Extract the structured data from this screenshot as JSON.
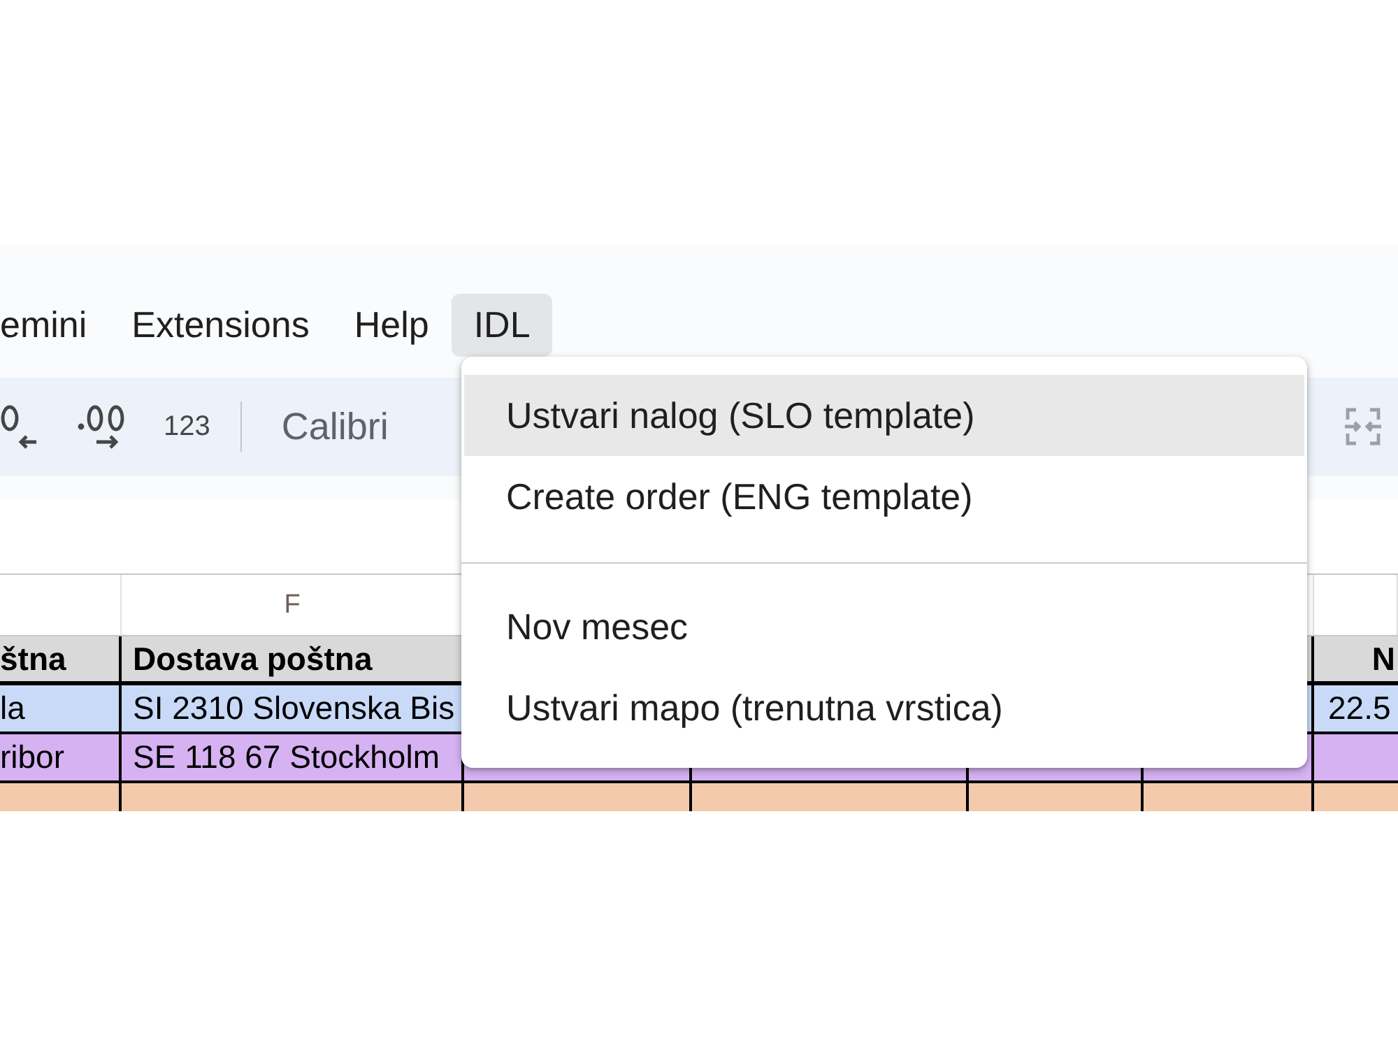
{
  "menu_bar": {
    "items": [
      {
        "label": "emini",
        "open": false
      },
      {
        "label": "Extensions",
        "open": false
      },
      {
        "label": "Help",
        "open": false
      },
      {
        "label": "IDL",
        "open": true
      }
    ]
  },
  "toolbar": {
    "number_format": "123",
    "font": "Calibri"
  },
  "sheet": {
    "column_letters": {
      "column_f": "F"
    },
    "rows": [
      {
        "kind": "header",
        "color": "#d9d9d9",
        "column_e": "štna",
        "column_f": "Dostava poštna",
        "column_k": "N"
      },
      {
        "kind": "data",
        "color": "#c9daf8",
        "column_e": "la",
        "column_f": "SI 2310 Slovenska Bis",
        "column_k": "22.5"
      },
      {
        "kind": "data",
        "color": "#d6b2f3",
        "column_e": "ribor",
        "column_f": "SE 118 67 Stockholm"
      },
      {
        "kind": "data",
        "color": "#f3caab"
      }
    ]
  },
  "dropdown_menu": {
    "groups": [
      [
        {
          "label": "Ustvari nalog (SLO template)",
          "highlighted": true
        },
        {
          "label": "Create order (ENG template)",
          "highlighted": false
        }
      ],
      [
        {
          "label": "Nov mesec",
          "highlighted": false
        },
        {
          "label": "Ustvari mapo (trenutna vrstica)",
          "highlighted": false
        }
      ]
    ]
  }
}
